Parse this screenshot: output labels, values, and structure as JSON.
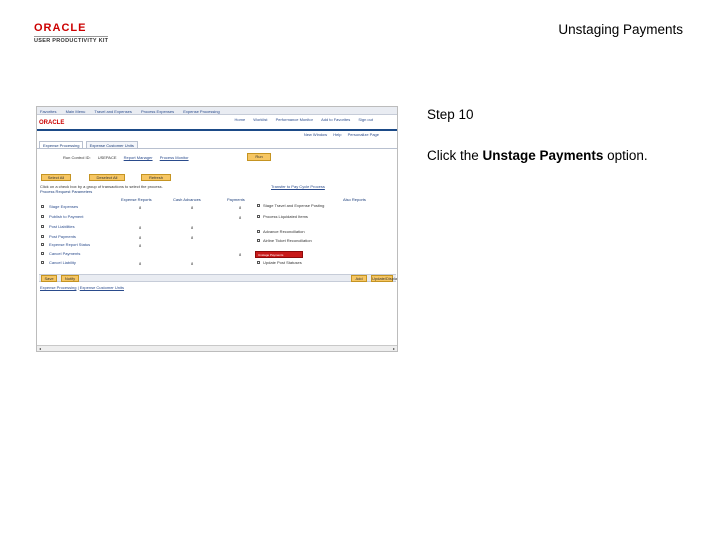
{
  "logo": {
    "brand": "ORACLE",
    "product": "USER PRODUCTIVITY KIT"
  },
  "slide_title": "Unstaging Payments",
  "step": {
    "title": "Step 10"
  },
  "instruction": {
    "prefix": "Click the ",
    "target": "Unstage Payments",
    "suffix": " option."
  },
  "screenshot": {
    "menu_items": [
      "Favorites",
      "Main Menu",
      "Travel and Expenses",
      "Process Expenses",
      "Expense Processing"
    ],
    "header": {
      "brand": "ORACLE",
      "nav": [
        "Home",
        "Worklist",
        "Performance Monitor",
        "Add to Favorites",
        "Sign out"
      ]
    },
    "subnav": [
      "New Window",
      "Help",
      "Personalize Page"
    ],
    "tabs": [
      "Expense Processing",
      "Expense Customer Units"
    ],
    "run": {
      "run_control_label": "Run Control ID:",
      "run_control_value": "USEPACE",
      "report_manager": "Report Manager",
      "process_monitor": "Process Monitor",
      "run_button": "Run"
    },
    "buttons": {
      "select_all": "Select All",
      "deselect_all": "Deselect All",
      "refresh": "Refresh"
    },
    "instructions_text": "Click on a check box by a group of transactions to select the process.",
    "process_link": "Transfer to Pay Cycle Process",
    "section_title": "Process Request Parameters",
    "columns": [
      "Expense Reports",
      "Cash Advances",
      "Payments",
      "Also Reports"
    ],
    "rows": [
      {
        "label": "Stage Expenses",
        "values": [
          "8",
          "8",
          "8"
        ]
      },
      {
        "label": "Publish to Payment",
        "values": [
          "",
          "",
          "8"
        ]
      },
      {
        "label": "Post Liabilities",
        "values": [
          "8",
          "8",
          ""
        ]
      },
      {
        "label": "Post Payments",
        "values": [
          "8",
          "8",
          ""
        ]
      },
      {
        "label": "Expense Report Status",
        "values": [
          "8",
          "",
          ""
        ]
      },
      {
        "label": "Cancel Payments",
        "values": [
          "",
          "",
          "8"
        ]
      },
      {
        "label": "Cancel Liability",
        "values": [
          "8",
          "8",
          ""
        ]
      }
    ],
    "options": [
      "Stage Travel and Expense Posting",
      "Process Liquidated Items",
      "Advance Reconciliation",
      "Airline Ticket Reconciliation",
      "Unstage Payments",
      "Update Post Statuses"
    ],
    "footer_buttons": [
      "Save",
      "Notify",
      "Add",
      "Update/Display"
    ],
    "footer_links": [
      "Expense Processing",
      "Expense Customer Units"
    ]
  }
}
